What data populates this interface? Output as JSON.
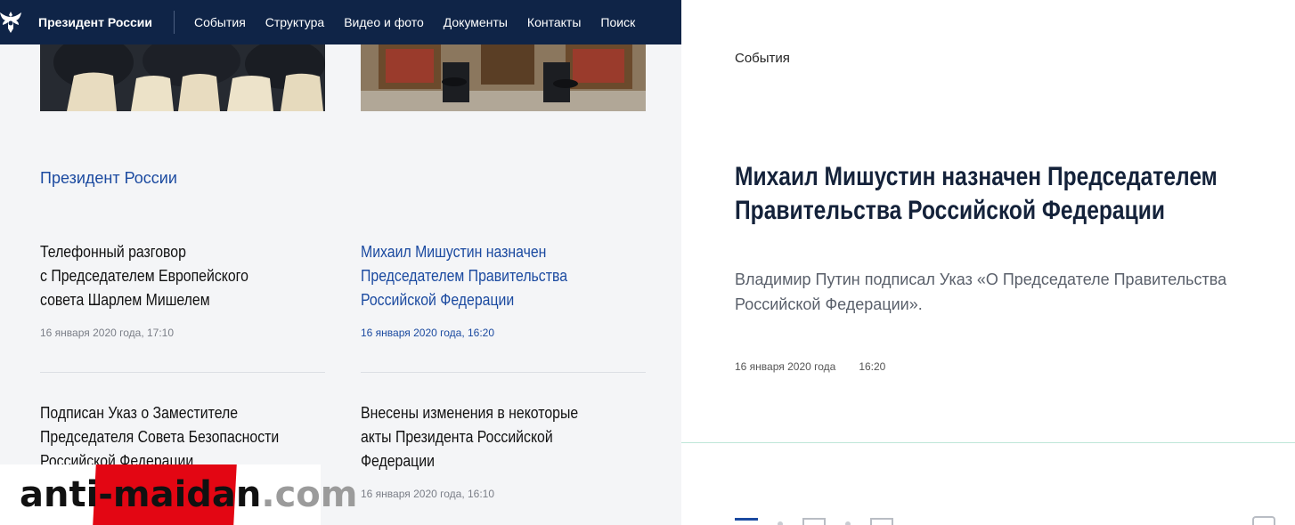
{
  "header": {
    "site_name": "Президент России",
    "nav": [
      "События",
      "Структура",
      "Видео и фото",
      "Документы",
      "Контакты",
      "Поиск"
    ]
  },
  "feed": {
    "section_title": "Президент России",
    "items": [
      {
        "title_lines": [
          "Телефонный разговор",
          "с Председателем Европейского",
          "совета Шарлем Мишелем"
        ],
        "date": "16 января 2020 года, 17:10",
        "active": false
      },
      {
        "title_lines": [
          "Михаил Мишустин назначен",
          "Председателем Правительства",
          "Российской Федерации"
        ],
        "date": "16 января 2020 года, 16:20",
        "active": true
      },
      {
        "title_lines": [
          "Подписан Указ о Заместителе",
          "Председателя Совета Безопасности",
          "Российской Федерации"
        ],
        "date": "",
        "active": false
      },
      {
        "title_lines": [
          "Внесены изменения в некоторые",
          "акты Президента Российской",
          "Федерации"
        ],
        "date": "16 января 2020 года, 16:10",
        "active": false
      }
    ]
  },
  "watermark": {
    "part1": "anti-",
    "part2": "maidan",
    "part3": ".com"
  },
  "article": {
    "breadcrumb": "События",
    "title_lines": [
      "Михаил Мишустин назначен Председателем",
      "Правительства Российской Федерации"
    ],
    "lead_lines": [
      "Владимир Путин подписал Указ «О Председателе Правительства",
      "Российской Федерации»."
    ],
    "date": "16 января 2020 года",
    "time": "16:20"
  },
  "colors": {
    "header_bg": "#0f2447",
    "accent": "#1b4aa0"
  },
  "icons": [
    "emblem-icon",
    "list-view-icon",
    "share-icon"
  ]
}
